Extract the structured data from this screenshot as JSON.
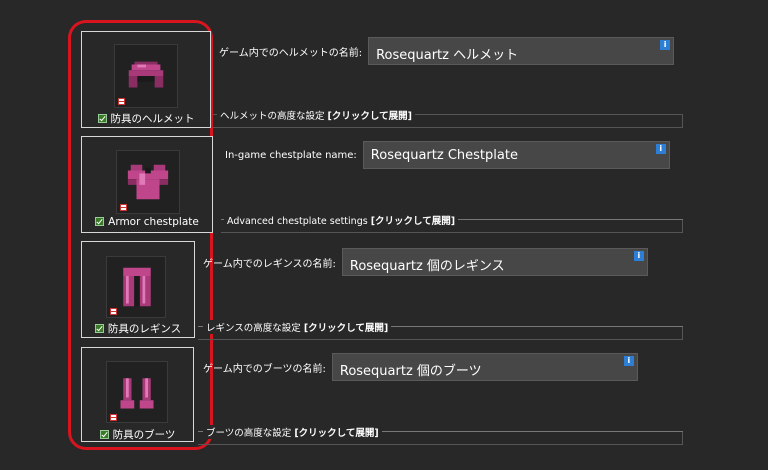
{
  "armor": [
    {
      "key": "helmet",
      "caption": "防具のヘルメット",
      "name_label": "ゲーム内でのヘルメットの名前:",
      "name_value": "Rosequartz ヘルメット",
      "advanced_label": "ヘルメットの高度な設定",
      "expand_label": "[クリックして展開]",
      "enabled": true
    },
    {
      "key": "chestplate",
      "caption": "Armor chestplate",
      "name_label": "In-game chestplate name:",
      "name_value": "Rosequartz Chestplate",
      "advanced_label": "Advanced chestplate settings",
      "expand_label": "[クリックして展開]",
      "enabled": true
    },
    {
      "key": "leggings",
      "caption": "防具のレギンス",
      "name_label": "ゲーム内でのレギンスの名前:",
      "name_value": "Rosequartz 個のレギンス",
      "advanced_label": "レギンスの高度な設定",
      "expand_label": "[クリックして展開]",
      "enabled": true
    },
    {
      "key": "boots",
      "caption": "防具のブーツ",
      "name_label": "ゲーム内でのブーツの名前:",
      "name_value": "Rosequartz 個のブーツ",
      "advanced_label": "ブーツの高度な設定",
      "expand_label": "[クリックして展開]",
      "enabled": true
    }
  ],
  "info_glyph": "i",
  "colors": {
    "highlight": "#d8141e",
    "armor": "#c0468c",
    "info": "#2d7fd6"
  }
}
